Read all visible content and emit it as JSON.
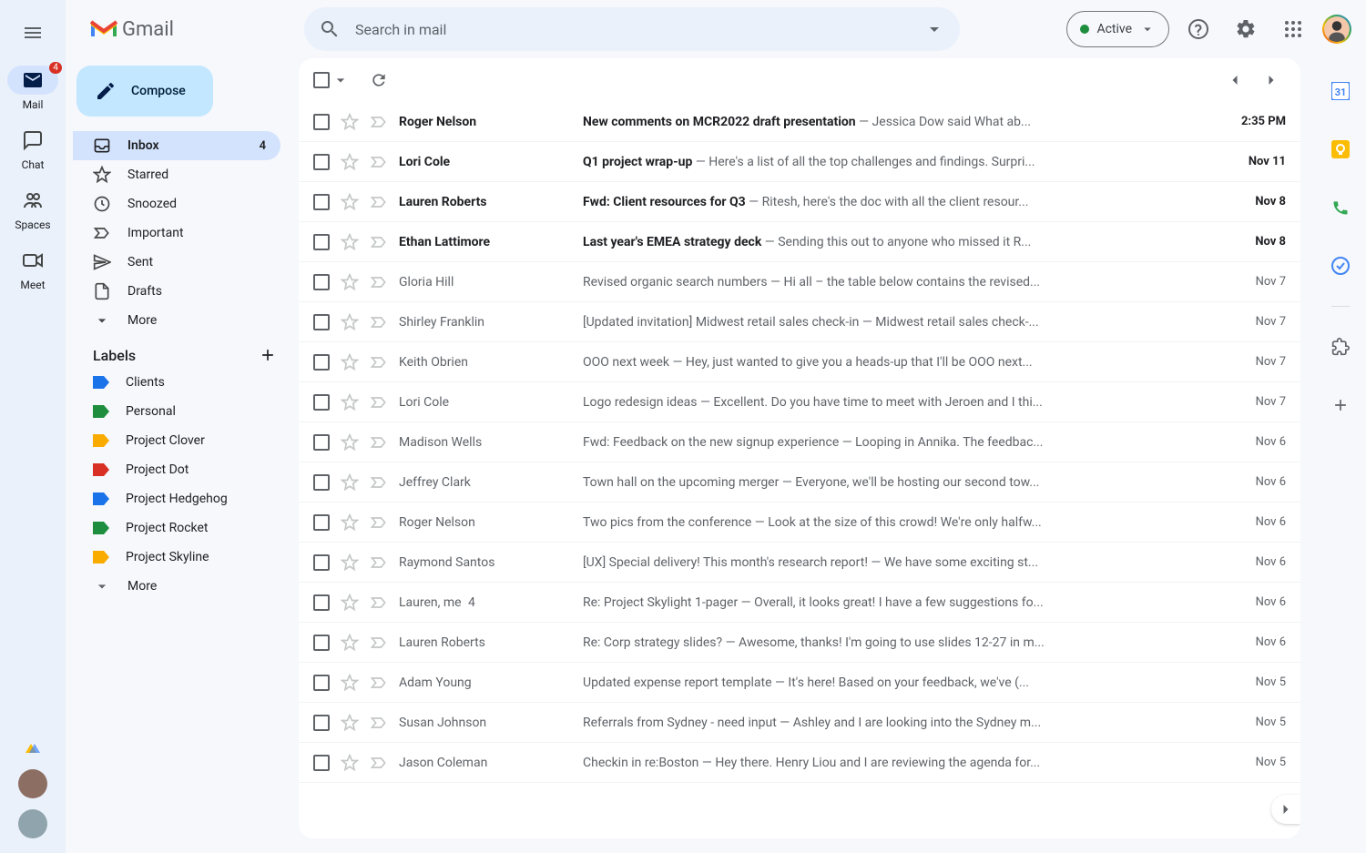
{
  "app_rail": {
    "items": [
      {
        "label": "Mail",
        "badge": "4",
        "active": true
      },
      {
        "label": "Chat"
      },
      {
        "label": "Spaces"
      },
      {
        "label": "Meet"
      }
    ]
  },
  "header": {
    "logo_text": "Gmail",
    "search_placeholder": "Search in mail",
    "status_label": "Active"
  },
  "sidebar": {
    "compose_label": "Compose",
    "nav": [
      {
        "label": "Inbox",
        "count": "4",
        "active": true,
        "icon": "inbox"
      },
      {
        "label": "Starred",
        "icon": "star"
      },
      {
        "label": "Snoozed",
        "icon": "clock"
      },
      {
        "label": "Important",
        "icon": "important"
      },
      {
        "label": "Sent",
        "icon": "send"
      },
      {
        "label": "Drafts",
        "icon": "draft"
      },
      {
        "label": "More",
        "icon": "expand"
      }
    ],
    "labels_header": "Labels",
    "labels": [
      {
        "label": "Clients",
        "color": "#1a73e8"
      },
      {
        "label": "Personal",
        "color": "#1e8e3e"
      },
      {
        "label": "Project Clover",
        "color": "#f9ab00"
      },
      {
        "label": "Project Dot",
        "color": "#d93025"
      },
      {
        "label": "Project Hedgehog",
        "color": "#1a73e8"
      },
      {
        "label": "Project Rocket",
        "color": "#1e8e3e"
      },
      {
        "label": "Project Skyline",
        "color": "#f9ab00"
      }
    ],
    "labels_more": "More"
  },
  "emails": [
    {
      "unread": true,
      "sender": "Roger Nelson",
      "subject": "New comments on MCR2022 draft presentation",
      "snippet": "Jessica Dow said What ab...",
      "date": "2:35 PM"
    },
    {
      "unread": true,
      "sender": "Lori Cole",
      "subject": "Q1 project wrap-up",
      "snippet": "Here's a list of all the top challenges and findings. Surpri...",
      "date": "Nov 11"
    },
    {
      "unread": true,
      "sender": "Lauren Roberts",
      "subject": "Fwd: Client resources for Q3",
      "snippet": "Ritesh, here's the doc with all the client resour...",
      "date": "Nov 8"
    },
    {
      "unread": true,
      "sender": "Ethan Lattimore",
      "subject": "Last year's EMEA strategy deck",
      "snippet": "Sending this out to anyone who missed it R...",
      "date": "Nov 8"
    },
    {
      "unread": false,
      "sender": "Gloria Hill",
      "subject": "Revised organic search numbers",
      "snippet": "Hi all – the table below contains the revised...",
      "date": "Nov 7"
    },
    {
      "unread": false,
      "sender": "Shirley Franklin",
      "subject": "[Updated invitation] Midwest retail sales check-in",
      "snippet": "Midwest retail sales check-...",
      "date": "Nov 7"
    },
    {
      "unread": false,
      "sender": "Keith Obrien",
      "subject": "OOO next week",
      "snippet": "Hey, just wanted to give you a heads-up that I'll be OOO next...",
      "date": "Nov 7"
    },
    {
      "unread": false,
      "sender": "Lori Cole",
      "subject": "Logo redesign ideas",
      "snippet": "Excellent. Do you have time to meet with Jeroen and I thi...",
      "date": "Nov 7"
    },
    {
      "unread": false,
      "sender": "Madison Wells",
      "subject": "Fwd: Feedback on the new signup experience",
      "snippet": "Looping in Annika. The feedbac...",
      "date": "Nov 6"
    },
    {
      "unread": false,
      "sender": "Jeffrey Clark",
      "subject": "Town hall on the upcoming merger",
      "snippet": "Everyone, we'll be hosting our second tow...",
      "date": "Nov 6"
    },
    {
      "unread": false,
      "sender": "Roger Nelson",
      "subject": "Two pics from the conference",
      "snippet": "Look at the size of this crowd! We're only halfw...",
      "date": "Nov 6"
    },
    {
      "unread": false,
      "sender": "Raymond Santos",
      "subject": "[UX] Special delivery! This month's research report!",
      "snippet": "We have some exciting st...",
      "date": "Nov 6"
    },
    {
      "unread": false,
      "sender": "Lauren, me",
      "thread_count": "4",
      "subject": "Re: Project Skylight 1-pager",
      "snippet": "Overall, it looks great! I have a few suggestions fo...",
      "date": "Nov 6"
    },
    {
      "unread": false,
      "sender": "Lauren Roberts",
      "subject": "Re: Corp strategy slides?",
      "snippet": "Awesome, thanks! I'm going to use slides 12-27 in m...",
      "date": "Nov 6"
    },
    {
      "unread": false,
      "sender": "Adam Young",
      "subject": "Updated expense report template",
      "snippet": "It's here! Based on your feedback, we've (...",
      "date": "Nov 5"
    },
    {
      "unread": false,
      "sender": "Susan Johnson",
      "subject": "Referrals from Sydney - need input",
      "snippet": "Ashley and I are looking into the Sydney m...",
      "date": "Nov 5"
    },
    {
      "unread": false,
      "sender": "Jason Coleman",
      "subject": "Checkin in re:Boston",
      "snippet": "Hey there. Henry Liou and I are reviewing the agenda for...",
      "date": "Nov 5"
    }
  ]
}
